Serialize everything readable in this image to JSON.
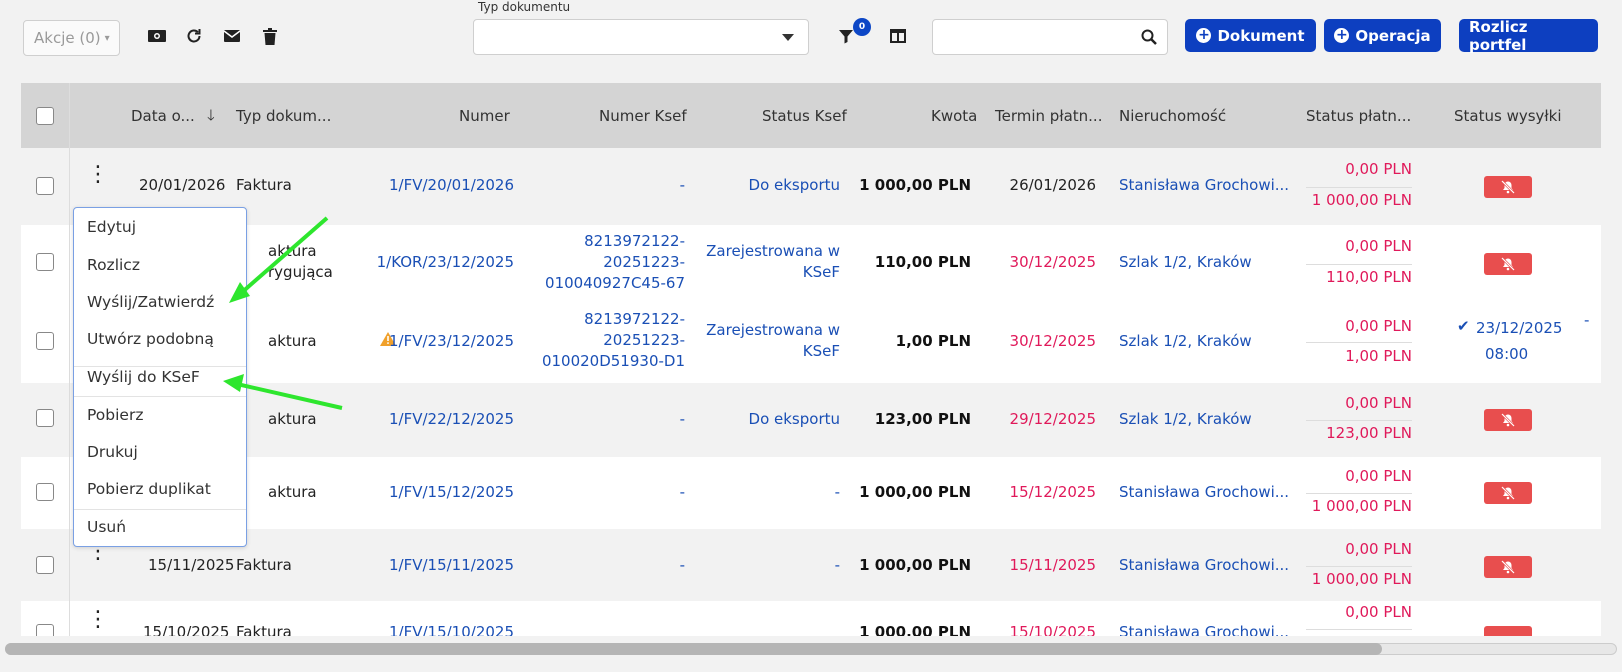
{
  "toolbar": {
    "akcje_label": "Akcje (0)",
    "typ_label": "Typ dokumentu",
    "typ_value": "",
    "filter_badge": "0",
    "search_value": "",
    "btn_dokument": "Dokument",
    "btn_operacja": "Operacja",
    "btn_rozlicz": "Rozlicz portfel"
  },
  "columns": {
    "data": "Data o...",
    "typ": "Typ dokum...",
    "numer": "Numer",
    "numer_ksef": "Numer Ksef",
    "status_ksef": "Status Ksef",
    "kwota": "Kwota",
    "termin": "Termin płatn...",
    "nieruchomosc": "Nieruchomość",
    "status_platn": "Status płatn...",
    "status_wysylki": "Status wysyłki"
  },
  "rows": [
    {
      "data": "20/01/2026",
      "typ": "Faktura",
      "numer": "1/FV/20/01/2026",
      "ksef1": "-",
      "ksef2": "",
      "ksef3": "",
      "status1": "Do eksportu",
      "status2": "",
      "kwota": "1 000,00 PLN",
      "termin": "26/01/2026",
      "nier": "Stanisława Grochowi...",
      "pay1": "0,00 PLN",
      "pay2": "1 000,00 PLN"
    },
    {
      "data": "",
      "typ": "aktura",
      "typ2": "rygująca",
      "numer": "1/KOR/23/12/2025",
      "ksef1": "8213972122-",
      "ksef2": "20251223-",
      "ksef3": "010040927C45-67",
      "status1": "Zarejestrowana w",
      "status2": "KSeF",
      "kwota": "110,00 PLN",
      "termin": "30/12/2025",
      "nier": "Szlak 1/2, Kraków",
      "pay1": "0,00 PLN",
      "pay2": "110,00 PLN"
    },
    {
      "data": "",
      "typ": "aktura",
      "numer": "1/FV/23/12/2025",
      "ksef1": "8213972122-",
      "ksef2": "20251223-",
      "ksef3": "010020D51930-D1",
      "status1": "Zarejestrowana w",
      "status2": "KSeF",
      "kwota": "1,00 PLN",
      "termin": "30/12/2025",
      "nier": "Szlak 1/2, Kraków",
      "pay1": "0,00 PLN",
      "pay2": "1,00 PLN",
      "sent_date": "23/12/2025",
      "sent_time": "08:00",
      "extra": "-"
    },
    {
      "data": "",
      "typ": "aktura",
      "numer": "1/FV/22/12/2025",
      "ksef1": "-",
      "status1": "Do eksportu",
      "kwota": "123,00 PLN",
      "termin": "29/12/2025",
      "nier": "Szlak 1/2, Kraków",
      "pay1": "0,00 PLN",
      "pay2": "123,00 PLN"
    },
    {
      "data": "",
      "typ": "aktura",
      "numer": "1/FV/15/12/2025",
      "ksef1": "-",
      "status1": "-",
      "kwota": "1 000,00 PLN",
      "termin": "15/12/2025",
      "nier": "Stanisława Grochowi...",
      "pay1": "0,00 PLN",
      "pay2": "1 000,00 PLN"
    },
    {
      "data": "15/11/2025",
      "typ": "Faktura",
      "numer": "1/FV/15/11/2025",
      "ksef1": "-",
      "status1": "-",
      "kwota": "1 000,00 PLN",
      "termin": "15/11/2025",
      "nier": "Stanisława Grochowi...",
      "pay1": "0,00 PLN",
      "pay2": "1 000,00 PLN"
    },
    {
      "data": "15/10/2025",
      "typ": "Faktura",
      "numer": "1/FV/15/10/2025",
      "kwota": "1 000,00 PLN",
      "termin": "15/10/2025",
      "nier": "Stanisława Grochowi...",
      "pay1": "0,00 PLN"
    }
  ],
  "menu": [
    "Edytuj",
    "Rozlicz",
    "Wyślij/Zatwierdź",
    "Utwórz podobną",
    "Wyślij do KSeF",
    "Pobierz",
    "Drukuj",
    "Pobierz duplikat",
    "Usuń"
  ],
  "colors": {
    "accent": "#0d3fc0",
    "link": "#1a4fb5",
    "danger": "#e0195a",
    "annotation_arrow": "#2ee62e"
  }
}
